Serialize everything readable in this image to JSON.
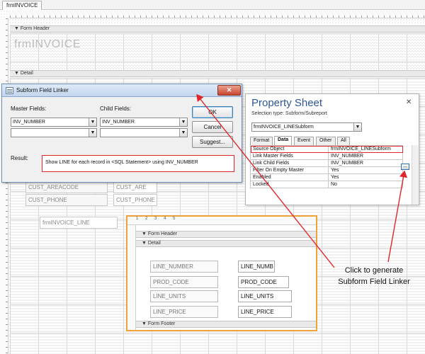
{
  "document_tab": "frmINVOICE",
  "main_form": {
    "title": "frmINVOICE",
    "sections": {
      "form_header": "Form Header",
      "detail": "Detail"
    },
    "controls": {
      "cust_areacode_label": "CUST_AREACODE",
      "cust_areacode_text": "CUST_ARE",
      "cust_phone_label": "CUST_PHONE",
      "cust_phone_text": "CUST_PHONE",
      "subform_label": "frmINVOICE_LINE"
    }
  },
  "subform": {
    "ruler": "1 2 3 4 5",
    "sections": {
      "form_header": "Form Header",
      "detail": "Detail",
      "form_footer": "Form Footer"
    },
    "rows": [
      {
        "label": "LINE_NUMBER",
        "field": "LINE_NUMB"
      },
      {
        "label": "PROD_CODE",
        "field": "PROD_CODE"
      },
      {
        "label": "LINE_UNITS",
        "field": "LINE_UNITS"
      },
      {
        "label": "LINE_PRICE",
        "field": "LINE_PRICE"
      }
    ]
  },
  "dialog": {
    "title": "Subform Field Linker",
    "close_glyph": "✕",
    "master_label": "Master Fields:",
    "child_label": "Child Fields:",
    "master_field_1": "INV_NUMBER",
    "master_field_2": "",
    "child_field_1": "INV_NUMBER",
    "child_field_2": "",
    "ok_label": "OK",
    "cancel_label": "Cancel",
    "suggest_label": "Suggest...",
    "result_label": "Result:",
    "result_text": "Show LINE for each record in <SQL Statement> using INV_NUMBER"
  },
  "property_sheet": {
    "title": "Property Sheet",
    "close_glyph": "✕",
    "selection_type": "Selection type:  Subform/Subreport",
    "object_combo": "frmINVOICE_LINESubform",
    "tabs": [
      "Format",
      "Data",
      "Event",
      "Other",
      "All"
    ],
    "active_tab": "Data",
    "build_glyph": "...",
    "properties": [
      {
        "name": "Source Object",
        "value": "frmINVOICE_LINESubform"
      },
      {
        "name": "Link Master Fields",
        "value": "INV_NUMBER"
      },
      {
        "name": "Link Child Fields",
        "value": "INV_NUMBER"
      },
      {
        "name": "Filter On Empty Master",
        "value": "Yes"
      },
      {
        "name": "Enabled",
        "value": "Yes"
      },
      {
        "name": "Locked",
        "value": "No"
      }
    ]
  },
  "callout": {
    "line1": "Click to generate",
    "line2": "Subform Field Linker"
  },
  "colors": {
    "accent_red": "#e0262b",
    "subform_border": "#f0a33a",
    "ps_title": "#2b5797"
  }
}
